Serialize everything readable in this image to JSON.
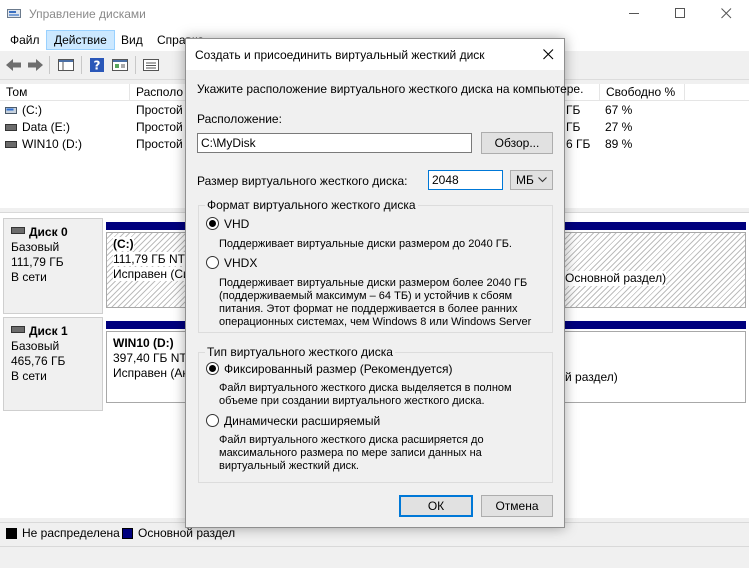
{
  "window": {
    "title": "Управление дисками"
  },
  "menu": {
    "items": [
      "Файл",
      "Действие",
      "Вид",
      "Справка"
    ]
  },
  "toolbar": {
    "icons": [
      "back-arrow-icon",
      "forward-arrow-icon",
      "console-tree-icon",
      "help-icon",
      "properties-icon",
      "list-view-icon"
    ]
  },
  "volume_list": {
    "headers": [
      "Том",
      "Располо",
      "",
      "",
      "Свободно %"
    ],
    "rows": [
      {
        "name": "(C:)",
        "layout": "Простой",
        "free_tail": "ГБ",
        "free_pct": "67 %"
      },
      {
        "name": "Data (E:)",
        "layout": "Простой",
        "free_tail": "ГБ",
        "free_pct": "27 %"
      },
      {
        "name": "WIN10 (D:)",
        "layout": "Простой",
        "free_tail": "6 ГБ",
        "free_pct": "89 %"
      }
    ]
  },
  "disks": [
    {
      "name": "Диск 0",
      "type": "Базовый",
      "size": "111,79 ГБ",
      "status": "В сети",
      "partition": {
        "label": "(C:)",
        "size": "111,79 ГБ NTF",
        "state": "Исправен (Си",
        "tail": "Основной раздел)"
      }
    },
    {
      "name": "Диск 1",
      "type": "Базовый",
      "size": "465,76 ГБ",
      "status": "В сети",
      "partition": {
        "label": "WIN10 (D:)",
        "size": "397,40 ГБ NTF",
        "state": "Исправен (Ак",
        "tail": "й раздел)"
      }
    }
  ],
  "legend": {
    "unallocated": "Не распределена",
    "primary": "Основной раздел",
    "unallocated_color": "#000000",
    "primary_color": "#00007d"
  },
  "dialog": {
    "title": "Создать и присоединить виртуальный жесткий диск",
    "instruction": "Укажите расположение виртуального жесткого диска на компьютере.",
    "location_label": "Расположение:",
    "location_value": "C:\\MyDisk",
    "browse_label": "Обзор...",
    "size_label": "Размер виртуального жесткого диска:",
    "size_value": "2048",
    "unit_value": "МБ",
    "format_group": {
      "title": "Формат виртуального жесткого диска",
      "vhd_label": "VHD",
      "vhd_desc": "Поддерживает виртуальные диски размером до 2040 ГБ.",
      "vhdx_label": "VHDX",
      "vhdx_desc_1": "Поддерживает виртуальные диски размером более 2040 ГБ",
      "vhdx_desc_2": "(поддерживаемый максимум – 64 ТБ) и устойчив к сбоям",
      "vhdx_desc_3": "питания. Этот формат не поддерживается в более ранних",
      "vhdx_desc_4": "операционных системах, чем Windows 8 или Windows Server",
      "selected": "VHD"
    },
    "type_group": {
      "title": "Тип виртуального жесткого диска",
      "fixed_label": "Фиксированный размер (Рекомендуется)",
      "fixed_desc_1": "Файл виртуального жесткого диска выделяется в полном",
      "fixed_desc_2": "объеме при создании виртуального жесткого диска.",
      "dynamic_label": "Динамически расширяемый",
      "dynamic_desc_1": "Файл виртуального жесткого диска расширяется до",
      "dynamic_desc_2": "максимального размера по мере записи данных на",
      "dynamic_desc_3": "виртуальный жесткий диск.",
      "selected": "Фиксированный размер (Рекомендуется)"
    },
    "ok_label": "ОК",
    "cancel_label": "Отмена"
  },
  "colors": {
    "accent": "#0078d7",
    "primary_partition": "#00007d",
    "menu_highlight": "#cce8ff"
  }
}
